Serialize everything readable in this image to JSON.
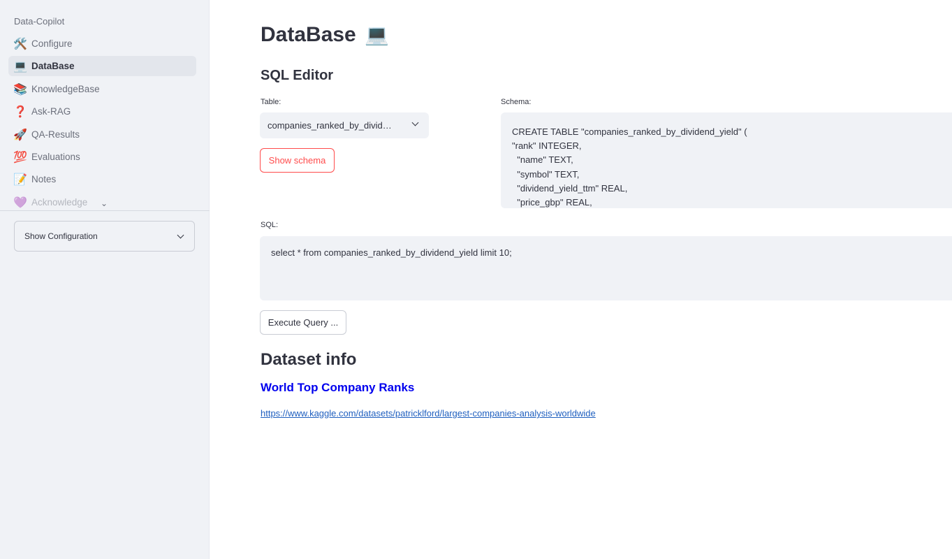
{
  "sidebar": {
    "app_name": "Data-Copilot",
    "items": [
      {
        "icon": "🛠️",
        "icon_name": "tools-icon",
        "label": "Configure"
      },
      {
        "icon": "💻",
        "icon_name": "laptop-icon",
        "label": "DataBase"
      },
      {
        "icon": "📚",
        "icon_name": "books-icon",
        "label": "KnowledgeBase"
      },
      {
        "icon": "❓",
        "icon_name": "question-icon",
        "label": "Ask-RAG"
      },
      {
        "icon": "🚀",
        "icon_name": "rocket-icon",
        "label": "QA-Results"
      },
      {
        "icon": "💯",
        "icon_name": "hundred-icon",
        "label": "Evaluations"
      },
      {
        "icon": "📝",
        "icon_name": "memo-icon",
        "label": "Notes"
      },
      {
        "icon": "💜",
        "icon_name": "purple-heart-icon",
        "label": "Acknowledge"
      }
    ],
    "active_index": 1,
    "config_expander": "Show Configuration"
  },
  "main": {
    "title": "DataBase",
    "title_icon": "💻",
    "sql_editor_title": "SQL Editor",
    "table_label": "Table:",
    "table_selected": "companies_ranked_by_divid…",
    "show_schema_label": "Show schema",
    "schema_label": "Schema:",
    "schema_text": "CREATE TABLE \"companies_ranked_by_dividend_yield\" (\n\"rank\" INTEGER,\n  \"name\" TEXT,\n  \"symbol\" TEXT,\n  \"dividend_yield_ttm\" REAL,\n  \"price_gbp\" REAL,",
    "sql_label": "SQL:",
    "sql_text": "select * from companies_ranked_by_dividend_yield limit 10;",
    "execute_label": "Execute Query ...",
    "dataset_info_title": "Dataset info",
    "dataset_name": "World Top Company Ranks",
    "dataset_url": "https://www.kaggle.com/datasets/patricklford/largest-companies-analysis-worldwide"
  },
  "colors": {
    "sidebar_bg": "#f0f2f6",
    "accent_red": "#ff4b4b",
    "link_blue": "#1f5fbf",
    "heading_blue": "#0000ee"
  }
}
